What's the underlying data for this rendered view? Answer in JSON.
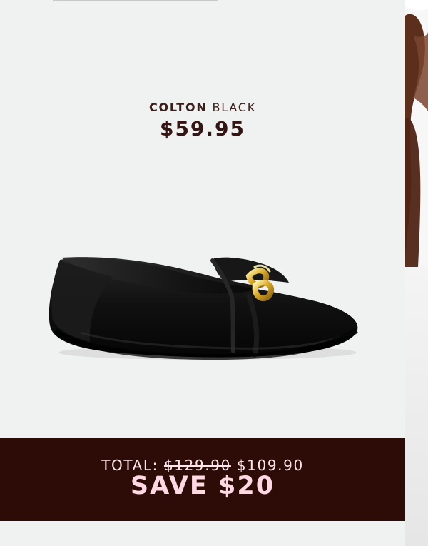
{
  "product": {
    "name": "COLTON",
    "color": "BLACK",
    "price": "$59.95"
  },
  "promo": {
    "total_label": "TOTAL:",
    "original_total": "$129.90",
    "sale_total": "$109.90",
    "save_text": "SAVE $20"
  },
  "colors": {
    "maroon": "#2d0c08",
    "pink_text": "#ffd8e3",
    "dark_text": "#341514"
  }
}
